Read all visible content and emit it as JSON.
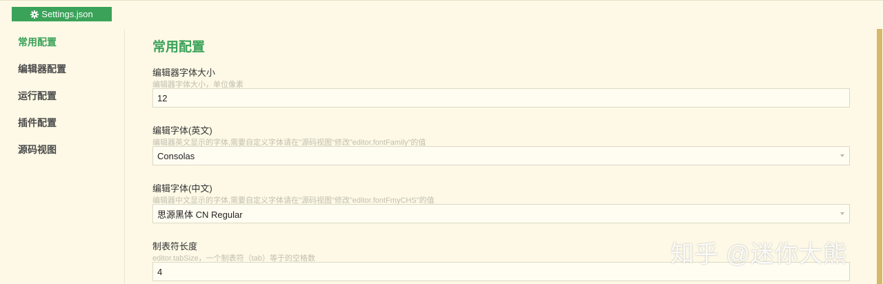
{
  "file_tab": {
    "label": "Settings.json",
    "icon": "gear-icon"
  },
  "sidebar": {
    "items": [
      {
        "label": "常用配置",
        "active": true
      },
      {
        "label": "编辑器配置",
        "active": false
      },
      {
        "label": "运行配置",
        "active": false
      },
      {
        "label": "插件配置",
        "active": false
      },
      {
        "label": "源码视图",
        "active": false
      }
    ]
  },
  "main": {
    "section_title": "常用配置",
    "fields": [
      {
        "label": "编辑器字体大小",
        "description": "编辑器字体大小，单位像素",
        "value": "12",
        "type": "input"
      },
      {
        "label": "编辑字体(英文)",
        "description": "编辑器英文显示的字体,需要自定义字体请在\"源码视图\"修改\"editor.fontFamily\"的值",
        "value": "Consolas",
        "type": "select"
      },
      {
        "label": "编辑字体(中文)",
        "description": "编辑器中文显示的字体,需要自定义字体请在\"源码视图\"修改\"editor.fontFmyCHS\"的值",
        "value": "思源黑体 CN Regular",
        "type": "select"
      },
      {
        "label": "制表符长度",
        "description": "editor.tabSize，一个制表符（tab）等于的空格数",
        "value": "4",
        "type": "input"
      }
    ]
  },
  "watermark": "知乎 @迷你大熊",
  "colors": {
    "accent": "#3aa259",
    "background": "#fdf9e6",
    "scrollbar": "#d6b86a"
  }
}
